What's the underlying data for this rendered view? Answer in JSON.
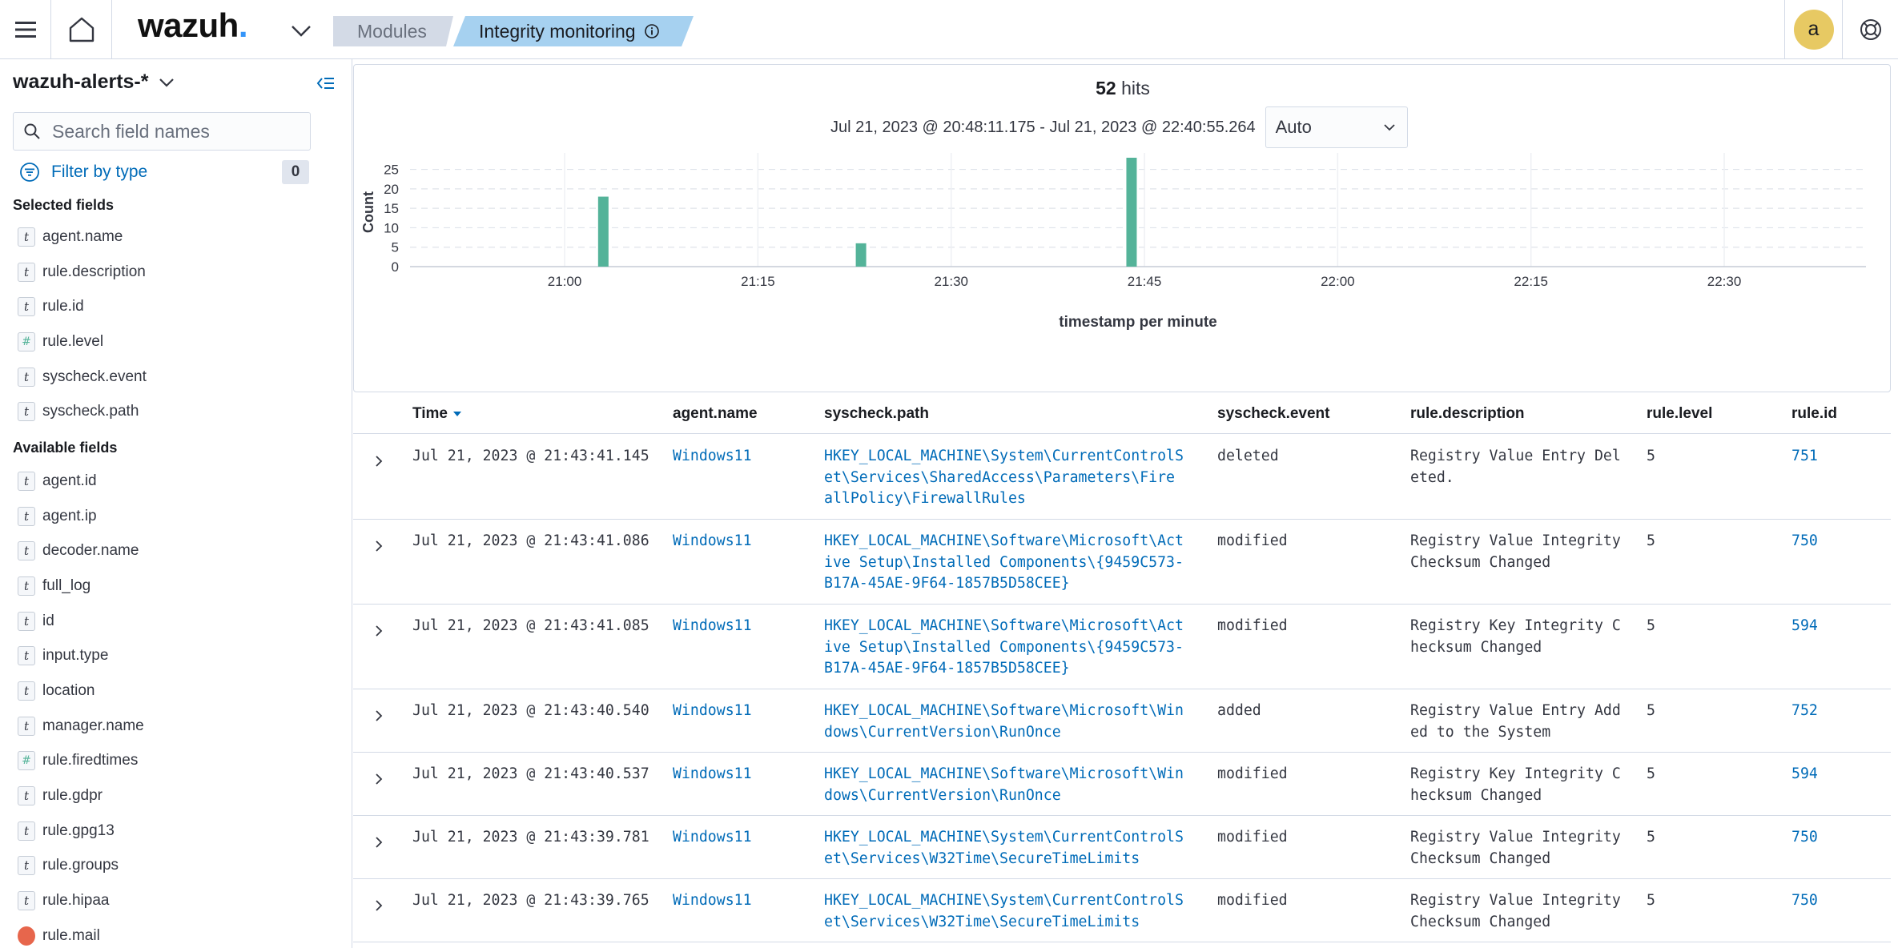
{
  "header": {
    "logo_text": "wazuh",
    "logo_dot": ".",
    "breadcrumbs": [
      "Modules",
      "Integrity monitoring"
    ],
    "user_initial": "a",
    "icons": [
      "menu-icon",
      "home-icon",
      "chevron-down-icon",
      "info-icon",
      "help-icon"
    ]
  },
  "sidebar": {
    "index_pattern": "wazuh-alerts-*",
    "search_placeholder": "Search field names",
    "filter_label": "Filter by type",
    "filter_count": "0",
    "selected_title": "Selected fields",
    "available_title": "Available fields",
    "selected_fields": [
      {
        "name": "agent.name",
        "type": "string"
      },
      {
        "name": "rule.description",
        "type": "string"
      },
      {
        "name": "rule.id",
        "type": "string"
      },
      {
        "name": "rule.level",
        "type": "number"
      },
      {
        "name": "syscheck.event",
        "type": "string"
      },
      {
        "name": "syscheck.path",
        "type": "string"
      }
    ],
    "available_fields": [
      {
        "name": "agent.id",
        "type": "string"
      },
      {
        "name": "agent.ip",
        "type": "string"
      },
      {
        "name": "decoder.name",
        "type": "string"
      },
      {
        "name": "full_log",
        "type": "string"
      },
      {
        "name": "id",
        "type": "string"
      },
      {
        "name": "input.type",
        "type": "string"
      },
      {
        "name": "location",
        "type": "string"
      },
      {
        "name": "manager.name",
        "type": "string"
      },
      {
        "name": "rule.firedtimes",
        "type": "number"
      },
      {
        "name": "rule.gdpr",
        "type": "string"
      },
      {
        "name": "rule.gpg13",
        "type": "string"
      },
      {
        "name": "rule.groups",
        "type": "string"
      },
      {
        "name": "rule.hipaa",
        "type": "string"
      },
      {
        "name": "rule.mail",
        "type": "geo"
      }
    ],
    "type_glyphs": {
      "string": "t",
      "number": "#",
      "geo": ""
    }
  },
  "summary": {
    "hits_count": "52",
    "hits_label": "hits",
    "time_range": "Jul 21, 2023 @ 20:48:11.175 - Jul 21, 2023 @ 22:40:55.264",
    "interval": "Auto"
  },
  "chart_data": {
    "type": "bar",
    "xlabel": "timestamp per minute",
    "ylabel": "Count",
    "ylim": [
      0,
      28
    ],
    "y_ticks": [
      0,
      5,
      10,
      15,
      20,
      25
    ],
    "x_ticks": [
      "21:00",
      "21:15",
      "21:30",
      "21:45",
      "22:00",
      "22:15",
      "22:30"
    ],
    "x_range": [
      "20:48",
      "22:41"
    ],
    "grid": true,
    "bar_color": "#54b399",
    "categories": [
      "21:03",
      "21:23",
      "21:44"
    ],
    "values": [
      18,
      6,
      28
    ]
  },
  "table": {
    "columns": [
      "Time",
      "agent.name",
      "syscheck.path",
      "syscheck.event",
      "rule.description",
      "rule.level",
      "rule.id"
    ],
    "rows": [
      {
        "time": "Jul 21, 2023 @ 21:43:41.145",
        "agent": "Windows11",
        "path": [
          "HKEY_LOCAL_MACHINE\\System\\CurrentControlS",
          "et\\Services\\SharedAccess\\Parameters\\Fire",
          "allPolicy\\FirewallRules"
        ],
        "event": "deleted",
        "desc": [
          "Registry Value Entry Del",
          "eted."
        ],
        "level": "5",
        "rule_id": "751"
      },
      {
        "time": "Jul 21, 2023 @ 21:43:41.086",
        "agent": "Windows11",
        "path": [
          "HKEY_LOCAL_MACHINE\\Software\\Microsoft\\Act",
          "ive Setup\\Installed Components\\{9459C573-",
          "B17A-45AE-9F64-1857B5D58CEE}"
        ],
        "event": "modified",
        "desc": [
          "Registry Value Integrity",
          "Checksum Changed"
        ],
        "level": "5",
        "rule_id": "750"
      },
      {
        "time": "Jul 21, 2023 @ 21:43:41.085",
        "agent": "Windows11",
        "path": [
          "HKEY_LOCAL_MACHINE\\Software\\Microsoft\\Act",
          "ive Setup\\Installed Components\\{9459C573-",
          "B17A-45AE-9F64-1857B5D58CEE}"
        ],
        "event": "modified",
        "desc": [
          "Registry Key Integrity C",
          "hecksum Changed"
        ],
        "level": "5",
        "rule_id": "594"
      },
      {
        "time": "Jul 21, 2023 @ 21:43:40.540",
        "agent": "Windows11",
        "path": [
          "HKEY_LOCAL_MACHINE\\Software\\Microsoft\\Win",
          "dows\\CurrentVersion\\RunOnce"
        ],
        "event": "added",
        "desc": [
          "Registry Value Entry Add",
          "ed to the System"
        ],
        "level": "5",
        "rule_id": "752"
      },
      {
        "time": "Jul 21, 2023 @ 21:43:40.537",
        "agent": "Windows11",
        "path": [
          "HKEY_LOCAL_MACHINE\\Software\\Microsoft\\Win",
          "dows\\CurrentVersion\\RunOnce"
        ],
        "event": "modified",
        "desc": [
          "Registry Key Integrity C",
          "hecksum Changed"
        ],
        "level": "5",
        "rule_id": "594"
      },
      {
        "time": "Jul 21, 2023 @ 21:43:39.781",
        "agent": "Windows11",
        "path": [
          "HKEY_LOCAL_MACHINE\\System\\CurrentControlS",
          "et\\Services\\W32Time\\SecureTimeLimits"
        ],
        "event": "modified",
        "desc": [
          "Registry Value Integrity",
          "Checksum Changed"
        ],
        "level": "5",
        "rule_id": "750"
      },
      {
        "time": "Jul 21, 2023 @ 21:43:39.765",
        "agent": "Windows11",
        "path": [
          "HKEY_LOCAL_MACHINE\\System\\CurrentControlS",
          "et\\Services\\W32Time\\SecureTimeLimits"
        ],
        "event": "modified",
        "desc": [
          "Registry Value Integrity",
          "Checksum Changed"
        ],
        "level": "5",
        "rule_id": "750"
      }
    ]
  },
  "colors": {
    "accent": "#006bb8",
    "bar": "#54b399",
    "breadcrumb_active": "#a6d1f0",
    "breadcrumb_inactive": "#d3dae6",
    "avatar": "#e7c963"
  }
}
